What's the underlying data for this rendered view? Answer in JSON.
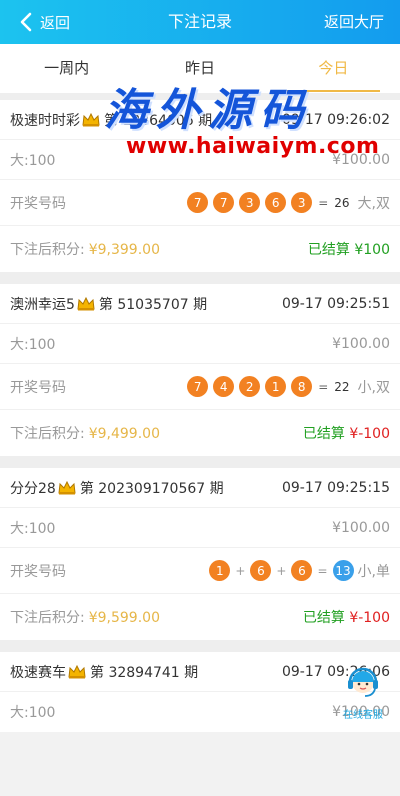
{
  "header": {
    "back_label": "返回",
    "title": "下注记录",
    "hall_label": "返回大厅"
  },
  "tabs": [
    {
      "label": "一周内",
      "active": false
    },
    {
      "label": "昨日",
      "active": false
    },
    {
      "label": "今日",
      "active": true
    }
  ],
  "watermark": {
    "cn": "海外源码",
    "url": "www.haiwaiym.com"
  },
  "records": [
    {
      "game": "极速时时彩",
      "period": "第 12864006 期",
      "time": "09-17 09:26:02",
      "bet": "大:100",
      "amount": "¥100.00",
      "draw_label": "开奖号码",
      "balls": [
        "7",
        "7",
        "3",
        "6",
        "3"
      ],
      "sum": "26",
      "result": "大,双",
      "score_label": "下注后积分:",
      "score": "¥9,399.00",
      "settled_label": "已结算",
      "settled_amount": "¥100"
    },
    {
      "game": "澳洲幸运5",
      "period": "第 51035707 期",
      "time": "09-17 09:25:51",
      "bet": "大:100",
      "amount": "¥100.00",
      "draw_label": "开奖号码",
      "balls": [
        "7",
        "4",
        "2",
        "1",
        "8"
      ],
      "sum": "22",
      "result": "小,双",
      "score_label": "下注后积分:",
      "score": "¥9,499.00",
      "settled_label": "已结算",
      "settled_amount": "¥-100"
    },
    {
      "game": "分分28",
      "period": "第 202309170567 期",
      "time": "09-17 09:25:15",
      "bet": "大:100",
      "amount": "¥100.00",
      "draw_label": "开奖号码",
      "balls": [
        "1",
        "6",
        "6"
      ],
      "sum": "13",
      "result": "小,单",
      "score_label": "下注后积分:",
      "score": "¥9,599.00",
      "settled_label": "已结算",
      "settled_amount": "¥-100"
    },
    {
      "game": "极速赛车",
      "period": "第 32894741 期",
      "time": "09-17 09:26:06",
      "bet": "大:100",
      "amount": "¥100.00"
    }
  ],
  "service": {
    "label": "在线客服"
  },
  "colors": {
    "header_start": "#1cc3ef",
    "header_end": "#139cee",
    "ball": "#f28122",
    "sum_ball": "#3aa0ea",
    "score": "#e6b648",
    "settled": "#22a022",
    "negative": "#e02020",
    "active_tab": "#f0b946"
  },
  "icons": [
    "chevron-left-icon",
    "crown-icon",
    "customer-service-icon"
  ]
}
